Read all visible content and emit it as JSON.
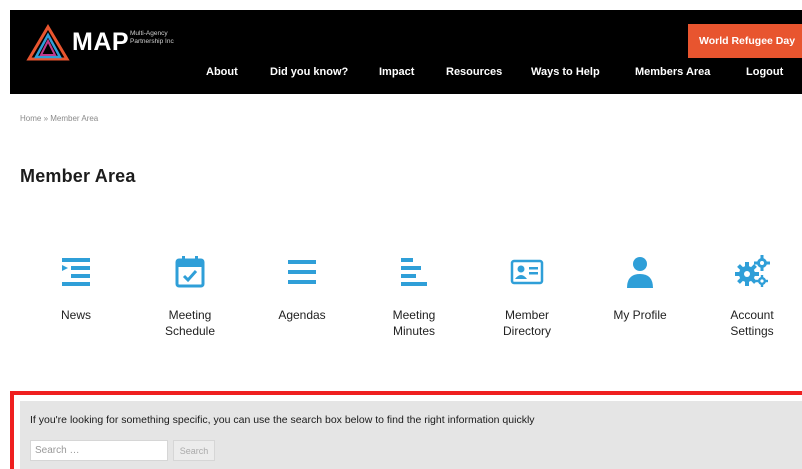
{
  "header": {
    "logo_text": "MAP",
    "logo_subtitle": "Multi-Agency Partnership Inc",
    "cta_label": "World Refugee Day",
    "nav": [
      "About",
      "Did you know?",
      "Impact",
      "Resources",
      "Ways to Help",
      "Members Area",
      "Logout"
    ]
  },
  "breadcrumb": "Home » Member Area",
  "page_title": "Member Area",
  "tiles": [
    {
      "label": "News",
      "icon": "news-list-icon"
    },
    {
      "label": "Meeting Schedule",
      "icon": "calendar-check-icon"
    },
    {
      "label": "Agendas",
      "icon": "list-lines-icon"
    },
    {
      "label": "Meeting Minutes",
      "icon": "align-left-icon"
    },
    {
      "label": "Member Directory",
      "icon": "contact-card-icon"
    },
    {
      "label": "My Profile",
      "icon": "user-icon"
    },
    {
      "label": "Account Settings",
      "icon": "gears-icon"
    }
  ],
  "search": {
    "prompt": "If you're looking for something specific, you can use the search box below to find the right information quickly",
    "placeholder": "Search …",
    "button_label": "Search"
  },
  "colors": {
    "accent_blue": "#2f9fd8",
    "cta_orange": "#e8552f",
    "highlight_red": "#ef1f1f",
    "header_bg": "#000000"
  }
}
